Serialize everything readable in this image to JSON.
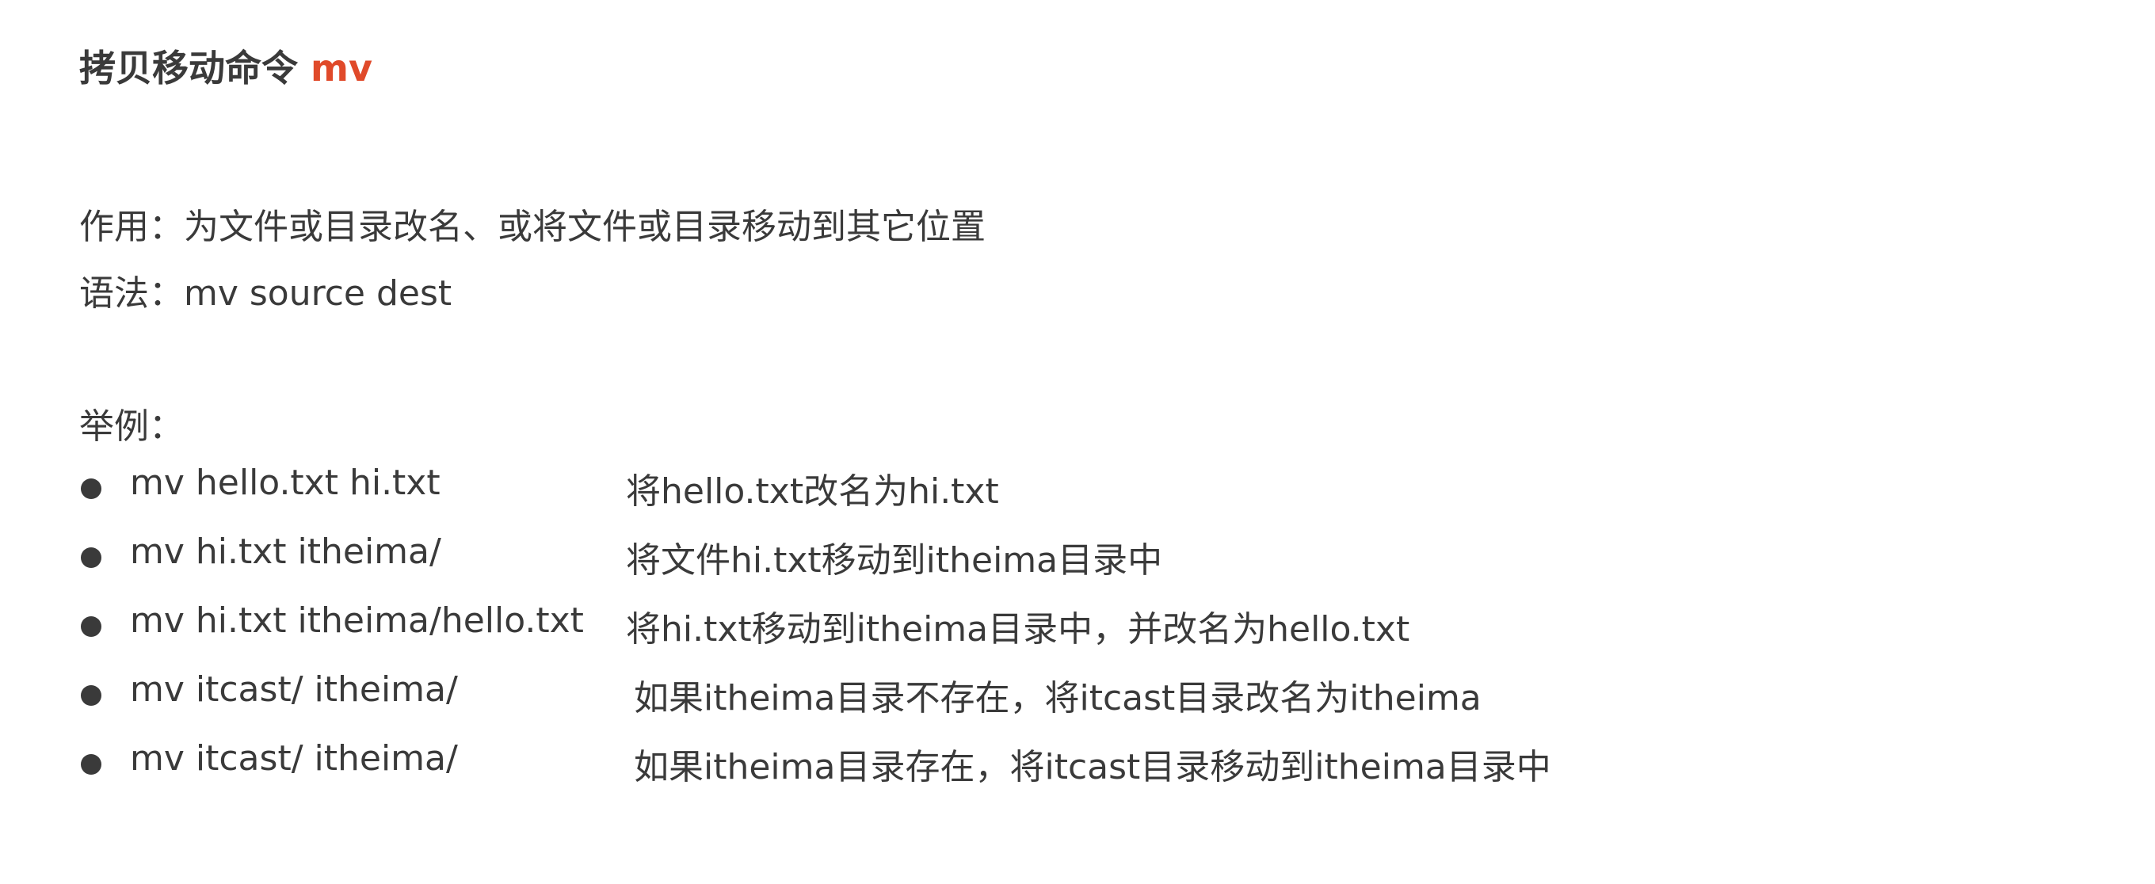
{
  "title": {
    "text": "拷贝移动命令",
    "command": "mv"
  },
  "purpose": {
    "label": "作用：",
    "text": "为文件或目录改名、或将文件或目录移动到其它位置"
  },
  "syntax": {
    "label": "语法：",
    "text": "mv source dest"
  },
  "examples_label": "举例：",
  "examples": [
    {
      "command": "mv hello.txt hi.txt",
      "description": "将hello.txt改名为hi.txt"
    },
    {
      "command": "mv hi.txt itheima/",
      "description": "将文件hi.txt移动到itheima目录中"
    },
    {
      "command": "mv hi.txt itheima/hello.txt",
      "description": "将hi.txt移动到itheima目录中，并改名为hello.txt"
    },
    {
      "command": "mv itcast/ itheima/",
      "description": "如果itheima目录不存在，将itcast目录改名为itheima"
    },
    {
      "command": "mv itcast/ itheima/",
      "description": "如果itheima目录存在，将itcast目录移动到itheima目录中"
    }
  ]
}
